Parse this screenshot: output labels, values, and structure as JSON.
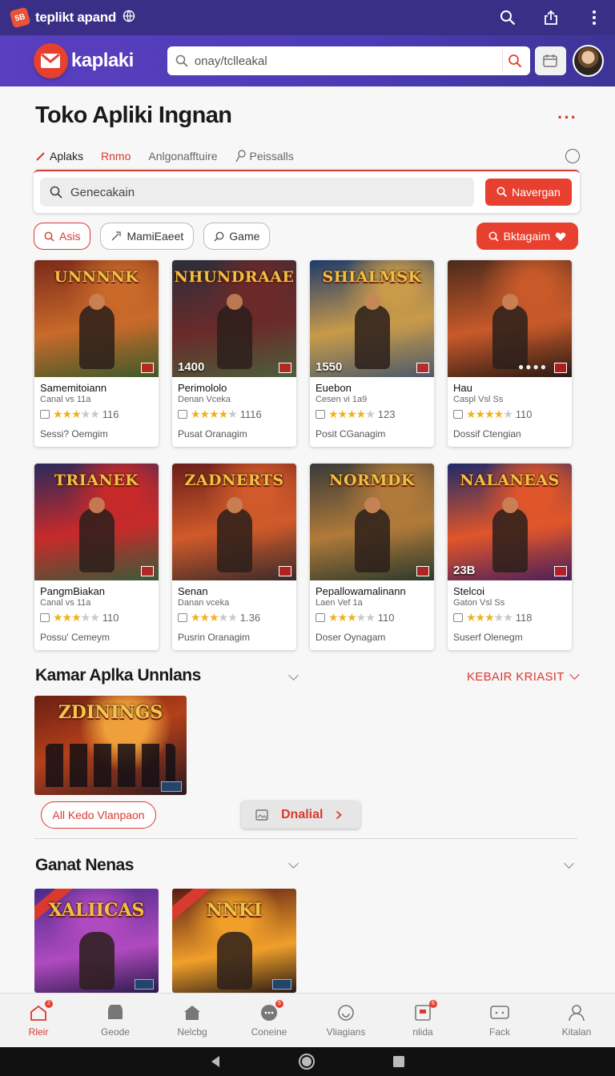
{
  "topbar": {
    "title": "teplikt apand",
    "badge": "5B"
  },
  "header": {
    "brand": "kaplaki",
    "search_value": "onay/tclleakal"
  },
  "page": {
    "title": "Toko Apliki Ingnan"
  },
  "tabs": [
    {
      "label": "Aplaks"
    },
    {
      "label": "Rnmo"
    },
    {
      "label": "Anlgonafftuire"
    },
    {
      "label": "Peissalls"
    }
  ],
  "search": {
    "placeholder": "Genecakain",
    "button": "Navergan"
  },
  "chips": [
    {
      "label": "Asis"
    },
    {
      "label": "MamiEaeet"
    },
    {
      "label": "Game"
    }
  ],
  "cta": {
    "label": "Bktagaim"
  },
  "apps": [
    {
      "art_title": "UNNNNK",
      "badge": "",
      "name": "Samemitoiann",
      "sub": "Canal vs 11a",
      "rating": 3,
      "count": "116",
      "foot": "Sessi? Oemgim",
      "palette": [
        "#7a2a1a",
        "#c96a2a",
        "#3c5a2a"
      ]
    },
    {
      "art_title": "NHUNDRAAE",
      "badge": "1400",
      "name": "Perimololo",
      "sub": "Denan Vceka",
      "rating": 4,
      "count": "1116",
      "foot": "Pusat Oranagim",
      "palette": [
        "#2b2f3a",
        "#6b2a2a",
        "#4b5e3a"
      ]
    },
    {
      "art_title": "SHIALMSK",
      "badge": "1550",
      "name": "Euebon",
      "sub": "Cesen vi 1a9",
      "rating": 4,
      "count": "123",
      "foot": "Posit CGanagim",
      "palette": [
        "#1f3c6a",
        "#c89a4a",
        "#4a5a6a"
      ]
    },
    {
      "art_title": "",
      "badge": "",
      "name": "Hau",
      "sub": "Caspl Vsl Ss",
      "rating": 4,
      "count": "110",
      "foot": "Dossif Ctengian",
      "palette": [
        "#4a2a1c",
        "#c85a2a",
        "#2a1a14"
      ]
    },
    {
      "art_title": "TRIANEK",
      "badge": "",
      "name": "PangmBiakan",
      "sub": "Canal vs 11a",
      "rating": 3,
      "count": "110",
      "foot": "Possu' Cemeym",
      "palette": [
        "#2a2a5a",
        "#c82a2a",
        "#3a5a3a"
      ]
    },
    {
      "art_title": "ZADNERTS",
      "badge": "",
      "name": "Senan",
      "sub": "Danan vceka",
      "rating": 3,
      "count": "1.36",
      "foot": "Pusrin Oranagim",
      "palette": [
        "#6a1f1a",
        "#d05a2a",
        "#3a2a2a"
      ]
    },
    {
      "art_title": "NORMDK",
      "badge": "",
      "name": "Pepallowamalinann",
      "sub": "Laen Vef 1a",
      "rating": 3,
      "count": "110",
      "foot": "Doser Oynagam",
      "palette": [
        "#3a3a3a",
        "#b07a3a",
        "#2a3a2a"
      ]
    },
    {
      "art_title": "NALANEAS",
      "badge": "23B",
      "name": "Stelcoi",
      "sub": "Gaton Vsl Ss",
      "rating": 3,
      "count": "118",
      "foot": "Suserf Olenegm",
      "palette": [
        "#1f2a6a",
        "#e0562a",
        "#4a1f5a"
      ]
    }
  ],
  "section1": {
    "title": "Kamar Aplka Unnlans",
    "see_all": "KEBAIR KRIASIT",
    "banner_title": "ZDININGS",
    "outline_button": "All Kedo Vlanpaon",
    "gray_button": "Dnalial"
  },
  "section2": {
    "title": "Ganat Nenas",
    "tiles": [
      {
        "title": "XALIICAS",
        "palette": [
          "#4a2a8a",
          "#b04ac0",
          "#2a1a4a"
        ]
      },
      {
        "title": "NNKI",
        "palette": [
          "#5a1a14",
          "#f0a02a",
          "#2a1a14"
        ]
      }
    ]
  },
  "bottom_nav": [
    {
      "label": "Rleir",
      "icon": "home-icon",
      "badge": "2"
    },
    {
      "label": "Geode",
      "icon": "folder-icon",
      "badge": ""
    },
    {
      "label": "Nelcbg",
      "icon": "house-icon",
      "badge": ""
    },
    {
      "label": "Coneine",
      "icon": "chat-icon",
      "badge": "5"
    },
    {
      "label": "Vliagians",
      "icon": "clock-icon",
      "badge": ""
    },
    {
      "label": "nlida",
      "icon": "message-icon",
      "badge": "6"
    },
    {
      "label": "Fack",
      "icon": "feedback-icon",
      "badge": ""
    },
    {
      "label": "Kitalan",
      "icon": "profile-icon",
      "badge": ""
    }
  ],
  "colors": {
    "accent": "#e8402f",
    "header": "#4c3bb5",
    "topbar": "#3a2e86",
    "star": "#f0b21a"
  }
}
